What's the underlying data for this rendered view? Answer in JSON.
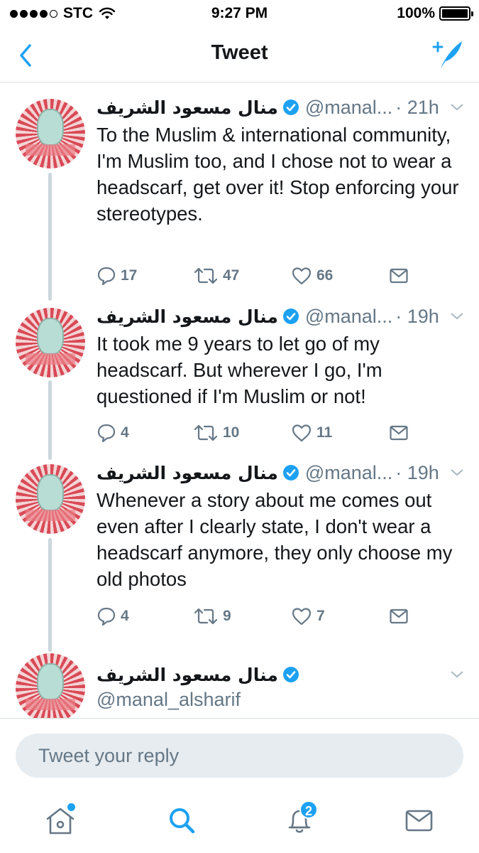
{
  "status_bar": {
    "carrier": "STC",
    "time": "9:27 PM",
    "battery": "100%"
  },
  "nav": {
    "title": "Tweet",
    "back_icon": "chevron-left-icon",
    "compose_icon": "compose-tweet-icon"
  },
  "colors": {
    "accent": "#1da1f2",
    "text_primary": "#14171a",
    "text_secondary": "#657786",
    "divider": "#ccd6dd"
  },
  "tweets": [
    {
      "name": "منال مسعود الشريف",
      "handle": "@manal...",
      "time": "· 21h",
      "text": "To the Muslim & international community, I'm Muslim too, and I chose not to wear a headscarf, get over it! Stop enforcing your stereotypes.",
      "replies": "17",
      "retweets": "47",
      "likes": "66"
    },
    {
      "name": "منال مسعود الشريف",
      "handle": "@manal...",
      "time": "· 19h",
      "text": "It took me 9 years to let go of my headscarf. But wherever I go, I'm questioned if I'm Muslim or not!",
      "replies": "4",
      "retweets": "10",
      "likes": "11"
    },
    {
      "name": "منال مسعود الشريف",
      "handle": "@manal...",
      "time": "· 19h",
      "text": "Whenever a story about me comes out even after I clearly state, I don't wear a headscarf anymore, they only choose my old photos",
      "replies": "4",
      "retweets": "9",
      "likes": "7"
    },
    {
      "name": "منال مسعود الشريف",
      "handle": "@manal_alsharif"
    }
  ],
  "reply": {
    "placeholder": "Tweet your reply"
  },
  "tab_bar": {
    "items": [
      "home-icon",
      "search-icon",
      "notifications-icon",
      "messages-icon"
    ],
    "notifications_badge": "2"
  }
}
